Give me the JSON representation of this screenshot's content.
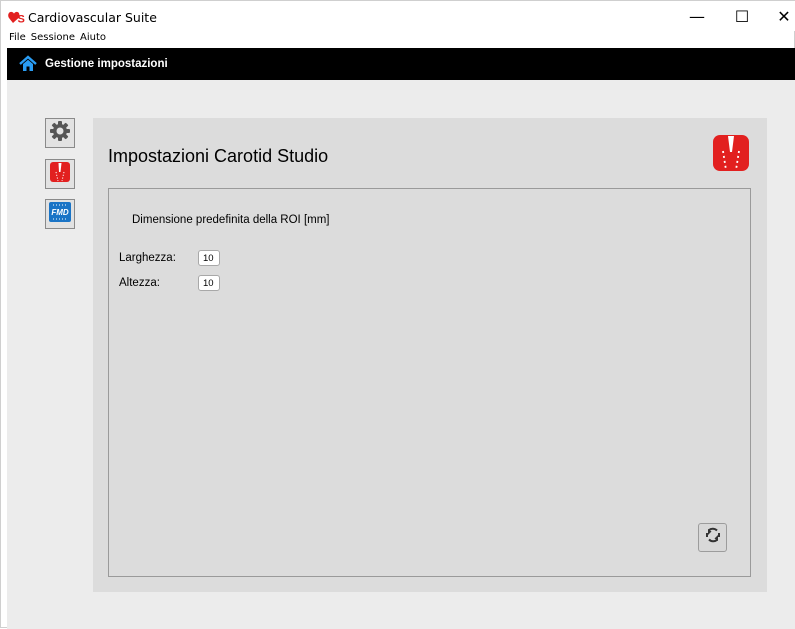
{
  "window": {
    "title": "Cardiovascular Suite",
    "controls": {
      "minimize": "—",
      "maximize": "☐",
      "close": "✕"
    }
  },
  "menu": {
    "items": [
      "File",
      "Sessione",
      "Aiuto"
    ]
  },
  "navbar": {
    "title": "Gestione impostazioni",
    "icon": "home-icon"
  },
  "sidebar": {
    "buttons": [
      {
        "name": "settings-gear",
        "icon": "gear-icon"
      },
      {
        "name": "carotid-studio",
        "icon": "carotid-studio-icon"
      },
      {
        "name": "fmd-studio",
        "icon": "fmd-icon",
        "label": "FMD"
      }
    ]
  },
  "panel": {
    "title": "Impostazioni Carotid Studio",
    "section_label": "Dimensione predefinita della ROI [mm]",
    "width_label": "Larghezza:",
    "width_value": "10",
    "height_label": "Altezza:",
    "height_value": "10"
  },
  "colors": {
    "accent_red": "#e2201f",
    "fmd_blue": "#1a74c6",
    "home_blue": "#2a9df4",
    "navbar_bg": "#000000"
  }
}
